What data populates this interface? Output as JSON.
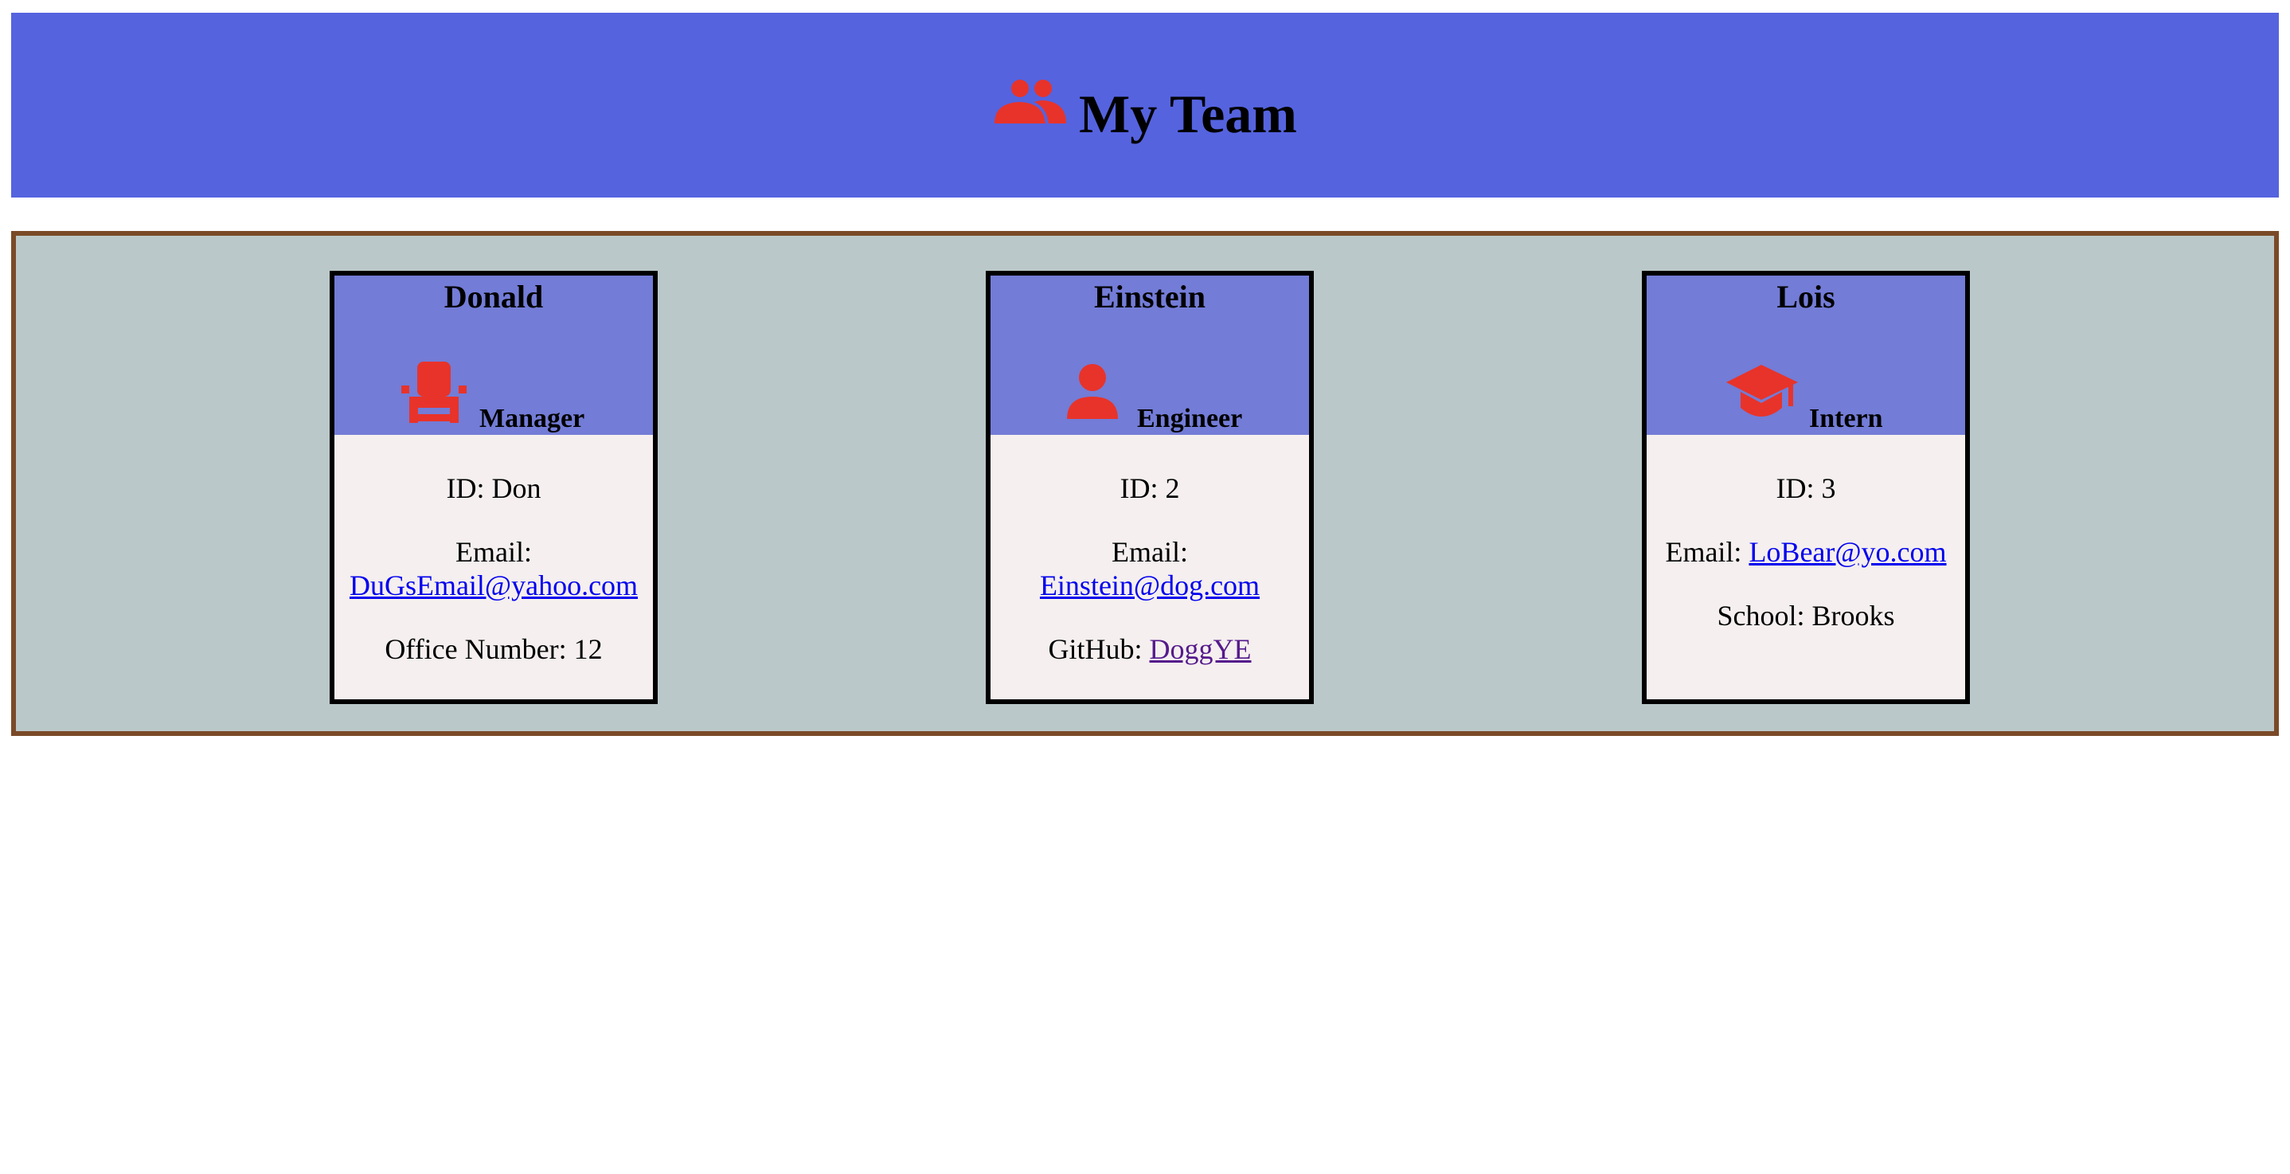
{
  "header": {
    "title": "My Team",
    "icon": "team-icon"
  },
  "colors": {
    "header_bg": "#5563df",
    "section_bg": "#bbc8c9",
    "section_border": "#7a4a28",
    "card_head_bg": "#737cd6",
    "card_body_bg": "#f5efef",
    "icon_color": "#e8332a",
    "link": "#0000ee",
    "visited_link": "#551a8b"
  },
  "cards": [
    {
      "name": "Donald",
      "role": "Manager",
      "role_icon": "chair-icon",
      "id_label": "ID: Don",
      "email_label": "Email:",
      "email": "DuGsEmail@yahoo.com",
      "extra_label": "Office Number: 12"
    },
    {
      "name": "Einstein",
      "role": "Engineer",
      "role_icon": "user-icon",
      "id_label": "ID: 2",
      "email_label": "Email:",
      "email": "Einstein@dog.com",
      "extra_label": "GitHub:",
      "extra_link": "DoggYE"
    },
    {
      "name": "Lois",
      "role": "Intern",
      "role_icon": "graduation-cap-icon",
      "id_label": "ID: 3",
      "email_label": "Email:",
      "email": "LoBear@yo.com",
      "extra_label": "School: Brooks"
    }
  ]
}
